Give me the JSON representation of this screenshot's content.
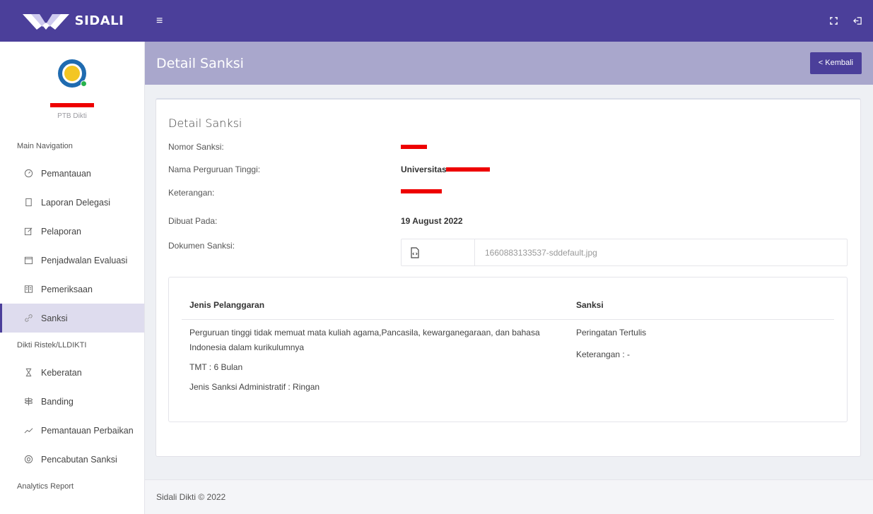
{
  "brand": {
    "name": "SIDALI"
  },
  "topbar": {
    "menu_icon": "hamburger-icon",
    "fullscreen_icon": "fullscreen-icon",
    "logout_icon": "logout-icon"
  },
  "profile": {
    "role": "PTB Dikti"
  },
  "sidebar": {
    "section_main": "Main Navigation",
    "main_items": [
      {
        "label": "Pemantauan",
        "icon": "gauge-icon"
      },
      {
        "label": "Laporan Delegasi",
        "icon": "document-icon"
      },
      {
        "label": "Pelaporan",
        "icon": "edit-icon"
      },
      {
        "label": "Penjadwalan Evaluasi",
        "icon": "calendar-icon"
      },
      {
        "label": "Pemeriksaan",
        "icon": "book-icon"
      },
      {
        "label": "Sanksi",
        "icon": "link-icon",
        "active": true
      }
    ],
    "section_dikti": "Dikti Ristek/LLDIKTI",
    "dikti_items": [
      {
        "label": "Keberatan",
        "icon": "hourglass-icon"
      },
      {
        "label": "Banding",
        "icon": "signpost-icon"
      },
      {
        "label": "Pemantauan Perbaikan",
        "icon": "trend-icon"
      },
      {
        "label": "Pencabutan Sanksi",
        "icon": "shield-icon"
      }
    ],
    "section_analytics": "Analytics Report"
  },
  "header": {
    "title": "Detail Sanksi",
    "back_label": "< Kembali"
  },
  "detail": {
    "title": "Detail Sanksi",
    "nomor_label": "Nomor Sanksi:",
    "nama_label": "Nama Perguruan Tinggi:",
    "nama_value": "Universitas",
    "keterangan_label": "Keterangan:",
    "dibuat_label": "Dibuat Pada:",
    "dibuat_value": "19 August 2022",
    "dokumen_label": "Dokumen Sanksi:",
    "dokumen_file": "1660883133537-sddefault.jpg"
  },
  "table": {
    "col_pelanggaran": "Jenis Pelanggaran",
    "col_sanksi": "Sanksi",
    "pelanggaran_line1": "Perguruan tinggi tidak memuat mata kuliah agama,Pancasila, kewarganegaraan, dan bahasa",
    "pelanggaran_line2": "Indonesia dalam kurikulumnya",
    "tmt": "TMT : 6 Bulan",
    "jenis_sanksi": "Jenis Sanksi Administratif : Ringan",
    "sanksi_value": "Peringatan Tertulis",
    "sanksi_keterangan": "Keterangan : -"
  },
  "footer": {
    "text": "Sidali Dikti © 2022"
  },
  "colors": {
    "primary": "#4b3f9a",
    "header_bg": "#a9a7cc",
    "active_bg": "#dedcee"
  }
}
